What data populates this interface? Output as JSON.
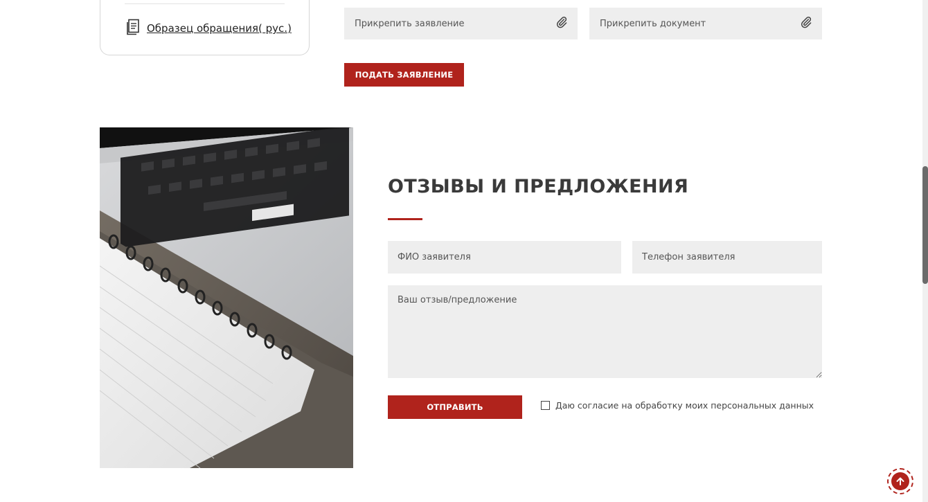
{
  "sample_card": {
    "link_label": "Образец обращения( рус.)"
  },
  "application_form": {
    "attach_statement": "Прикрепить заявление",
    "attach_document": "Прикрепить документ",
    "submit_label": "ПОДАТЬ ЗАЯВЛЕНИЕ"
  },
  "feedback": {
    "title": "ОТЗЫВЫ И ПРЕДЛОЖЕНИЯ",
    "name_placeholder": "ФИО заявителя",
    "phone_placeholder": "Телефон заявителя",
    "message_placeholder": "Ваш отзыв/предложение",
    "send_label": "ОТПРАВИТЬ",
    "consent_label": "Даю согласие на обработку моих персональных данных"
  },
  "colors": {
    "accent": "#b0231c",
    "field_bg": "#eeeeee"
  },
  "icons": [
    "document-icon",
    "paperclip-icon",
    "arrow-up-icon"
  ]
}
